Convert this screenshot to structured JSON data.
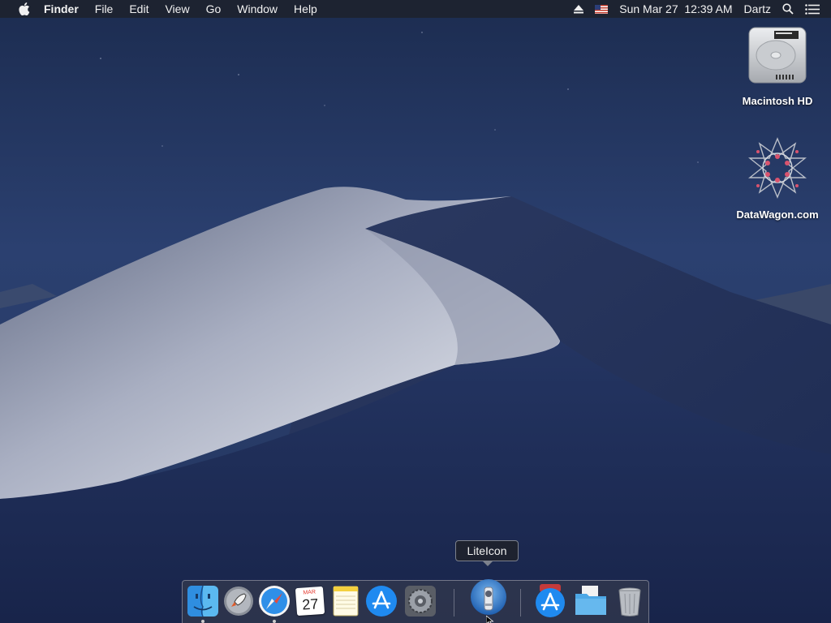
{
  "menubar": {
    "app_name": "Finder",
    "items": [
      "File",
      "Edit",
      "View",
      "Go",
      "Window",
      "Help"
    ],
    "status": {
      "datetime": "Sun Mar 27  12:39 AM",
      "user": "Dartz",
      "icons": [
        "eject-icon",
        "us-flag-icon",
        "spotlight-search-icon",
        "notification-center-icon"
      ]
    }
  },
  "desktop": {
    "icons": [
      {
        "label": "Macintosh HD",
        "icon": "hard-drive-icon"
      },
      {
        "label": "DataWagon.com",
        "icon": "datawagon-icon"
      }
    ]
  },
  "dock": {
    "tooltip": "LiteIcon",
    "calendar": {
      "month": "MAR",
      "day": "27"
    },
    "items": [
      {
        "name": "Finder",
        "icon": "finder-icon",
        "running": true
      },
      {
        "name": "Launchpad",
        "icon": "launchpad-icon",
        "running": false
      },
      {
        "name": "Safari",
        "icon": "safari-icon",
        "running": true
      },
      {
        "name": "Calendar",
        "icon": "calendar-icon",
        "running": false
      },
      {
        "name": "Notes",
        "icon": "notes-icon",
        "running": false
      },
      {
        "name": "App Store",
        "icon": "app-store-icon",
        "running": false
      },
      {
        "name": "System Preferences",
        "icon": "system-preferences-icon",
        "running": false
      },
      {
        "name": "LiteIcon",
        "icon": "liteicon-icon",
        "running": false
      },
      {
        "name": "Downloads",
        "icon": "downloads-stack-icon",
        "running": false
      },
      {
        "name": "Documents",
        "icon": "documents-folder-icon",
        "running": false
      },
      {
        "name": "Trash",
        "icon": "trash-icon",
        "running": false
      }
    ]
  },
  "colors": {
    "menubar_bg": "#1e222c",
    "wallpaper_sky": "#243862",
    "dune_highlight": "#b8bfd0"
  }
}
